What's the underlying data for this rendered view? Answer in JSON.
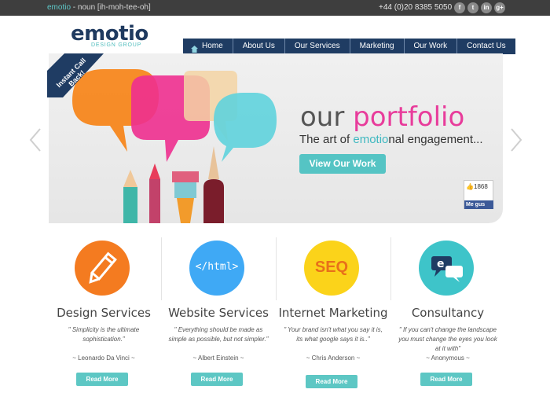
{
  "topbar": {
    "brand": "emotio",
    "tagline_rest": " - noun [ih-moh-tee-oh]",
    "phone": "+44 (0)20 8385 5050",
    "social": [
      {
        "icon": "facebook-icon",
        "glyph": "f"
      },
      {
        "icon": "twitter-icon",
        "glyph": "t"
      },
      {
        "icon": "linkedin-icon",
        "glyph": "in"
      },
      {
        "icon": "googleplus-icon",
        "glyph": "g+"
      }
    ]
  },
  "logo": {
    "word": "emotio",
    "sub": "DESIGN GROUP"
  },
  "nav": {
    "items": [
      "Home",
      "About Us",
      "Our Services",
      "Marketing",
      "Our Work",
      "Contact Us"
    ]
  },
  "banner": {
    "callback": "Instant Call Back!",
    "title_plain": "our ",
    "title_accent": "portfolio",
    "sub_before": "The art of ",
    "sub_accent": "emotio",
    "sub_after": "nal engagement...",
    "button": "View Our Work",
    "fb_count": "1868",
    "fb_like": "Me gus"
  },
  "services": [
    {
      "title": "Design Services",
      "quote": "\" Simplicity is the ultimate sophistication.\"",
      "author": "~ Leonardo Da Vinci ~",
      "button": "Read More",
      "icon": "pencil-icon",
      "color": "#f47b20",
      "glyph": ""
    },
    {
      "title": "Website Services",
      "quote": "\" Everything should be made as simple as possible, but not simpler.\"",
      "author": "~ Albert Einstein ~",
      "button": "Read More",
      "icon": "html-icon",
      "color": "#3fa9f5",
      "glyph": "</html>"
    },
    {
      "title": "Internet Marketing",
      "quote": "\" Your brand isn't what you say it is, its what google says it is..\"",
      "author": "~ Chris Anderson ~",
      "button": "Read More",
      "icon": "seo-icon",
      "color": "#fbd31a",
      "glyph": "SEQ"
    },
    {
      "title": "Consultancy",
      "quote": "\" If you can't change the landscape you must change the eyes you look at it with\"",
      "author": "~ Anonymous ~",
      "button": "Read More",
      "icon": "chat-icon",
      "color": "#3ec4c9",
      "glyph": ""
    }
  ],
  "colors": {
    "nav": "#1f3c63",
    "teal": "#55c4c4",
    "pink": "#e83c9b",
    "topbar": "#3e3e3e"
  }
}
